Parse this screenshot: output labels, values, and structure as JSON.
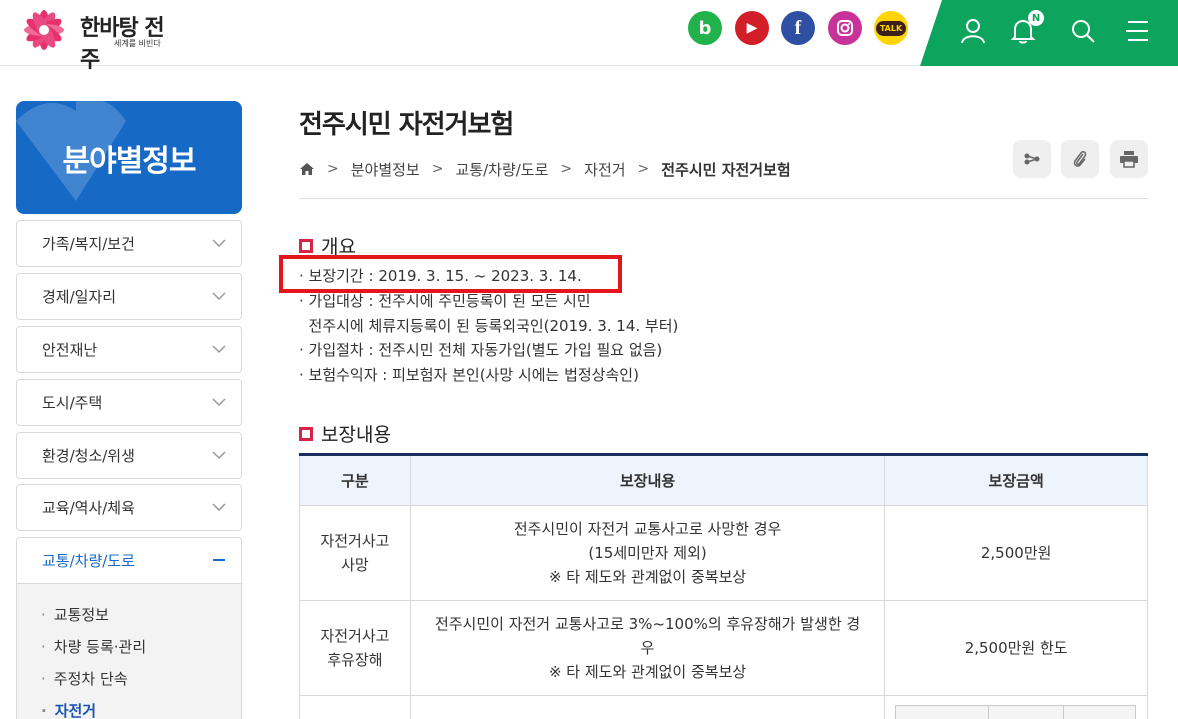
{
  "header": {
    "logo": {
      "text": "한바탕 전주",
      "sub": "세계를 비빈다"
    },
    "social": [
      {
        "name": "blog",
        "glyph": "b",
        "color": "#21b24b"
      },
      {
        "name": "youtube",
        "glyph": "▶",
        "color": "#d21e27"
      },
      {
        "name": "facebook",
        "glyph": "f",
        "color": "#2f4fa2"
      },
      {
        "name": "instagram",
        "glyph": "◎",
        "color": "#c7339a"
      },
      {
        "name": "kakaotalk",
        "glyph": "TALK",
        "color": "#ffd400"
      }
    ],
    "notification_badge": "N",
    "accent": "#0da45d"
  },
  "sidebar": {
    "title": "분야별정보",
    "items": [
      {
        "label": "가족/복지/보건"
      },
      {
        "label": "경제/일자리"
      },
      {
        "label": "안전재난"
      },
      {
        "label": "도시/주택"
      },
      {
        "label": "환경/청소/위생"
      },
      {
        "label": "교육/역사/체육"
      },
      {
        "label": "교통/차량/도로",
        "active": true
      }
    ],
    "sub_items": [
      {
        "label": "교통정보"
      },
      {
        "label": "차량 등록·관리"
      },
      {
        "label": "주정차 단속"
      },
      {
        "label": "자전거",
        "current": true
      }
    ]
  },
  "main": {
    "title": "전주시민 자전거보험",
    "breadcrumb": [
      "분야별정보",
      "교통/차량/도로",
      "자전거",
      "전주시민 자전거보험"
    ],
    "section1": {
      "title": "개요",
      "lines": [
        "· 보장기간 : 2019. 3. 15. ~ 2023. 3. 14.",
        "· 가입대상 : 전주시에 주민등록이 된 모든 시민",
        "  전주시에 체류지등록이 된 등록외국인(2019. 3. 14. 부터)",
        "· 가입절차 : 전주시민 전체 자동가입(별도 가입 필요 없음)",
        "· 보험수익자 : 피보험자 본인(사망 시에는 법정상속인)"
      ]
    },
    "section2": {
      "title": "보장내용",
      "headers": [
        "구분",
        "보장내용",
        "보장금액"
      ],
      "rows": [
        {
          "category": [
            "자전거사고",
            "사망"
          ],
          "content": [
            "전주시민이 자전거 교통사고로 사망한 경우",
            "(15세미만자 제외)",
            "※ 타 제도와 관계없이 중복보상"
          ],
          "amount": "2,500만원"
        },
        {
          "category": [
            "자전거사고",
            "후유장해"
          ],
          "content": [
            "전주시민이 자전거 교통사고로 3%~100%의 후유장해가 발생한 경",
            "우",
            "※ 타 제도와 관계없이 중복보상"
          ],
          "amount": "2,500만원 한도"
        }
      ]
    }
  }
}
